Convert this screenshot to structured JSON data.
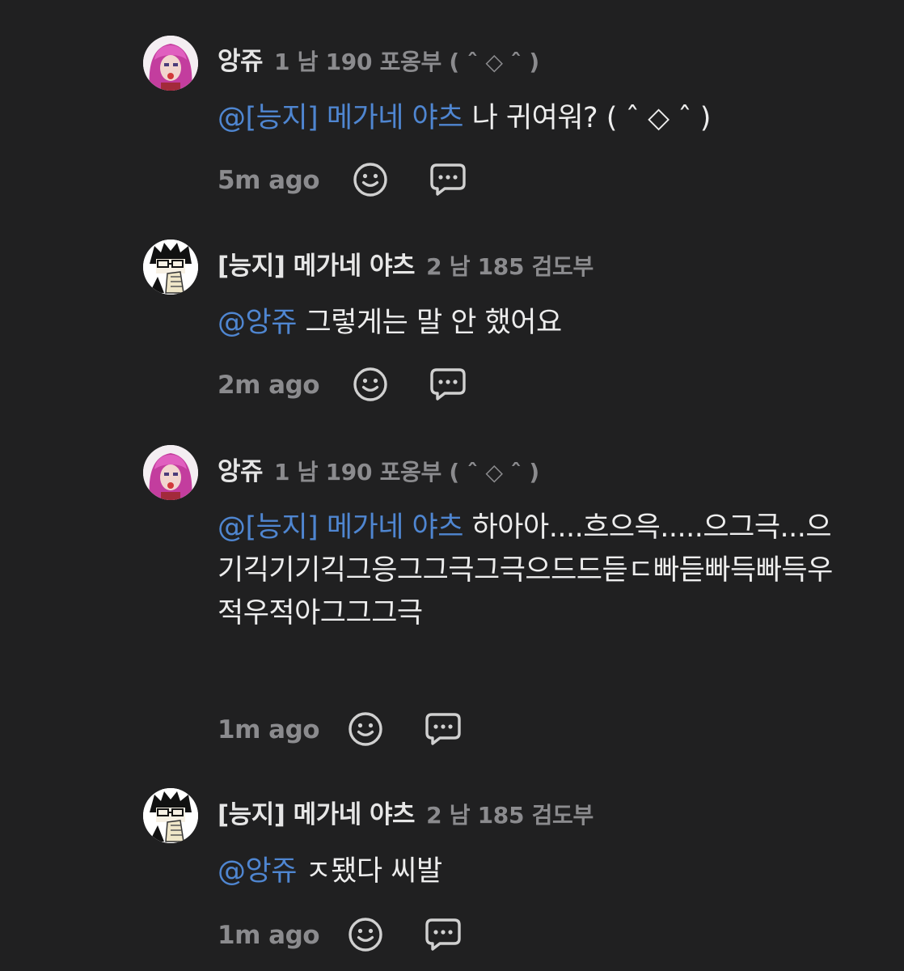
{
  "colors": {
    "background": "#202021",
    "mention": "#4f86d1",
    "meta": "#8b8b8e",
    "text": "#ededed"
  },
  "comments": [
    {
      "author": "앙쥬",
      "meta": "1 남 190 포옹부 ( ˆ ◇ ˆ )",
      "mention": "@[능지] 메가네 야츠",
      "text": " 나 귀여워? ( ˆ ◇ ˆ )",
      "time": "5m ago",
      "avatar_icon": "pink-hair-avatar-icon"
    },
    {
      "author": "[능지] 메가네 야츠",
      "meta": "2 남 185 검도부",
      "mention": "@앙쥬",
      "text": " 그렇게는 말 안 했어요",
      "time": "2m ago",
      "avatar_icon": "glasses-avatar-icon"
    },
    {
      "author": "앙쥬",
      "meta": "1 남 190 포옹부 ( ˆ ◇ ˆ )",
      "mention": "@[능지] 메가네 야츠",
      "text": " 하아아....흐으윽.....으그극...으기긱기기긱그응그그극그극으드드듣ㄷ빠듣빠득빠득우적우적아그그그극",
      "time": "1m ago",
      "avatar_icon": "pink-hair-avatar-icon"
    },
    {
      "author": "[능지] 메가네 야츠",
      "meta": "2 남 185 검도부",
      "mention": "@앙쥬",
      "text": " ㅈ됐다 씨발",
      "time": "1m ago",
      "avatar_icon": "glasses-avatar-icon"
    }
  ],
  "actions": {
    "react_icon": "smiley-icon",
    "reply_icon": "speech-bubble-icon"
  }
}
